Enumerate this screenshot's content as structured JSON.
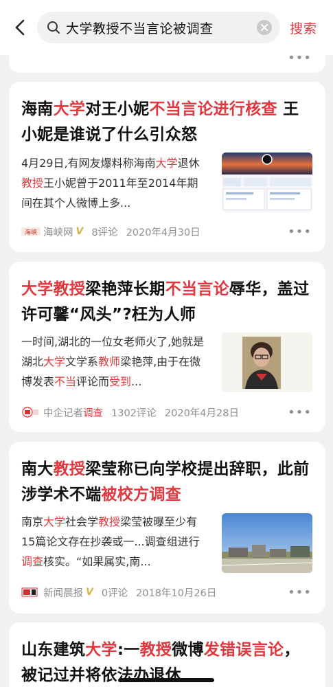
{
  "header": {
    "query": "大学教授不当言论被调查",
    "search_label": "搜索"
  },
  "more_label": "•••",
  "results": [
    {
      "title_parts": [
        {
          "t": "海南",
          "hl": false
        },
        {
          "t": "大学",
          "hl": true
        },
        {
          "t": "对王小妮",
          "hl": false
        },
        {
          "t": "不当言论进行核查",
          "hl": true
        },
        {
          "t": " 王小妮是谁说了什么引众怒",
          "hl": false
        }
      ],
      "snippet_parts": [
        {
          "t": "4月29日,有网友爆料称海南",
          "hl": false
        },
        {
          "t": "大学",
          "hl": true
        },
        {
          "t": "退休",
          "hl": false
        },
        {
          "t": "教授",
          "hl": true
        },
        {
          "t": "王小妮曾于2011年至2014年期间在其个人微博上多...",
          "hl": false
        }
      ],
      "source": "海峡网",
      "verified": "V",
      "comments": "8评论",
      "date": "2020年4月30日"
    },
    {
      "title_parts": [
        {
          "t": "大学教授",
          "hl": true
        },
        {
          "t": "梁艳萍长期",
          "hl": false
        },
        {
          "t": "不当言论",
          "hl": true
        },
        {
          "t": "辱华，盖过许可馨“风头”?枉为人师",
          "hl": false
        }
      ],
      "snippet_parts": [
        {
          "t": "一时间,湖北的一位女老师火了,她就是湖北",
          "hl": false
        },
        {
          "t": "大学",
          "hl": true
        },
        {
          "t": "文学系",
          "hl": false
        },
        {
          "t": "教师",
          "hl": true
        },
        {
          "t": "梁艳萍,由于在微博发表",
          "hl": false
        },
        {
          "t": "不当",
          "hl": true
        },
        {
          "t": "评论而",
          "hl": false
        },
        {
          "t": "受到",
          "hl": true
        },
        {
          "t": "...",
          "hl": false
        }
      ],
      "source_parts": [
        {
          "t": "中企记者",
          "hl": false
        },
        {
          "t": "调查",
          "hl": true
        }
      ],
      "comments": "1302评论",
      "date": "2020年4月28日"
    },
    {
      "title_parts": [
        {
          "t": "南大",
          "hl": false
        },
        {
          "t": "教授",
          "hl": true
        },
        {
          "t": "梁莹称已向学校提出辞职，此前涉学术不端",
          "hl": false
        },
        {
          "t": "被校方调查",
          "hl": true
        }
      ],
      "snippet_parts": [
        {
          "t": "南京",
          "hl": false
        },
        {
          "t": "大学",
          "hl": true
        },
        {
          "t": "社会学",
          "hl": false
        },
        {
          "t": "教授",
          "hl": true
        },
        {
          "t": "梁莹被曝至少有15篇论文存在抄袭或一...调查组进行",
          "hl": false
        },
        {
          "t": "调查",
          "hl": true
        },
        {
          "t": "核实。“如果属实,南...",
          "hl": false
        }
      ],
      "source": "新闻晨报",
      "verified": "V",
      "comments": "0评论",
      "date": "2018年10月26日"
    },
    {
      "title_parts": [
        {
          "t": "山东建筑",
          "hl": false
        },
        {
          "t": "大学",
          "hl": true
        },
        {
          "t": ":一",
          "hl": false
        },
        {
          "t": "教授",
          "hl": true
        },
        {
          "t": "微博",
          "hl": false
        },
        {
          "t": "发错误言论",
          "hl": true
        },
        {
          "t": "，被记过并将依法办退休",
          "hl": false
        }
      ]
    }
  ],
  "colors": {
    "accent": "#e0383e",
    "meta_gray": "#8e8e93",
    "verified_gold": "#d8b54a",
    "page_bg": "#f1f1f3"
  },
  "icons": [
    "back-arrow-icon",
    "search-icon",
    "clear-icon",
    "more-icon"
  ]
}
